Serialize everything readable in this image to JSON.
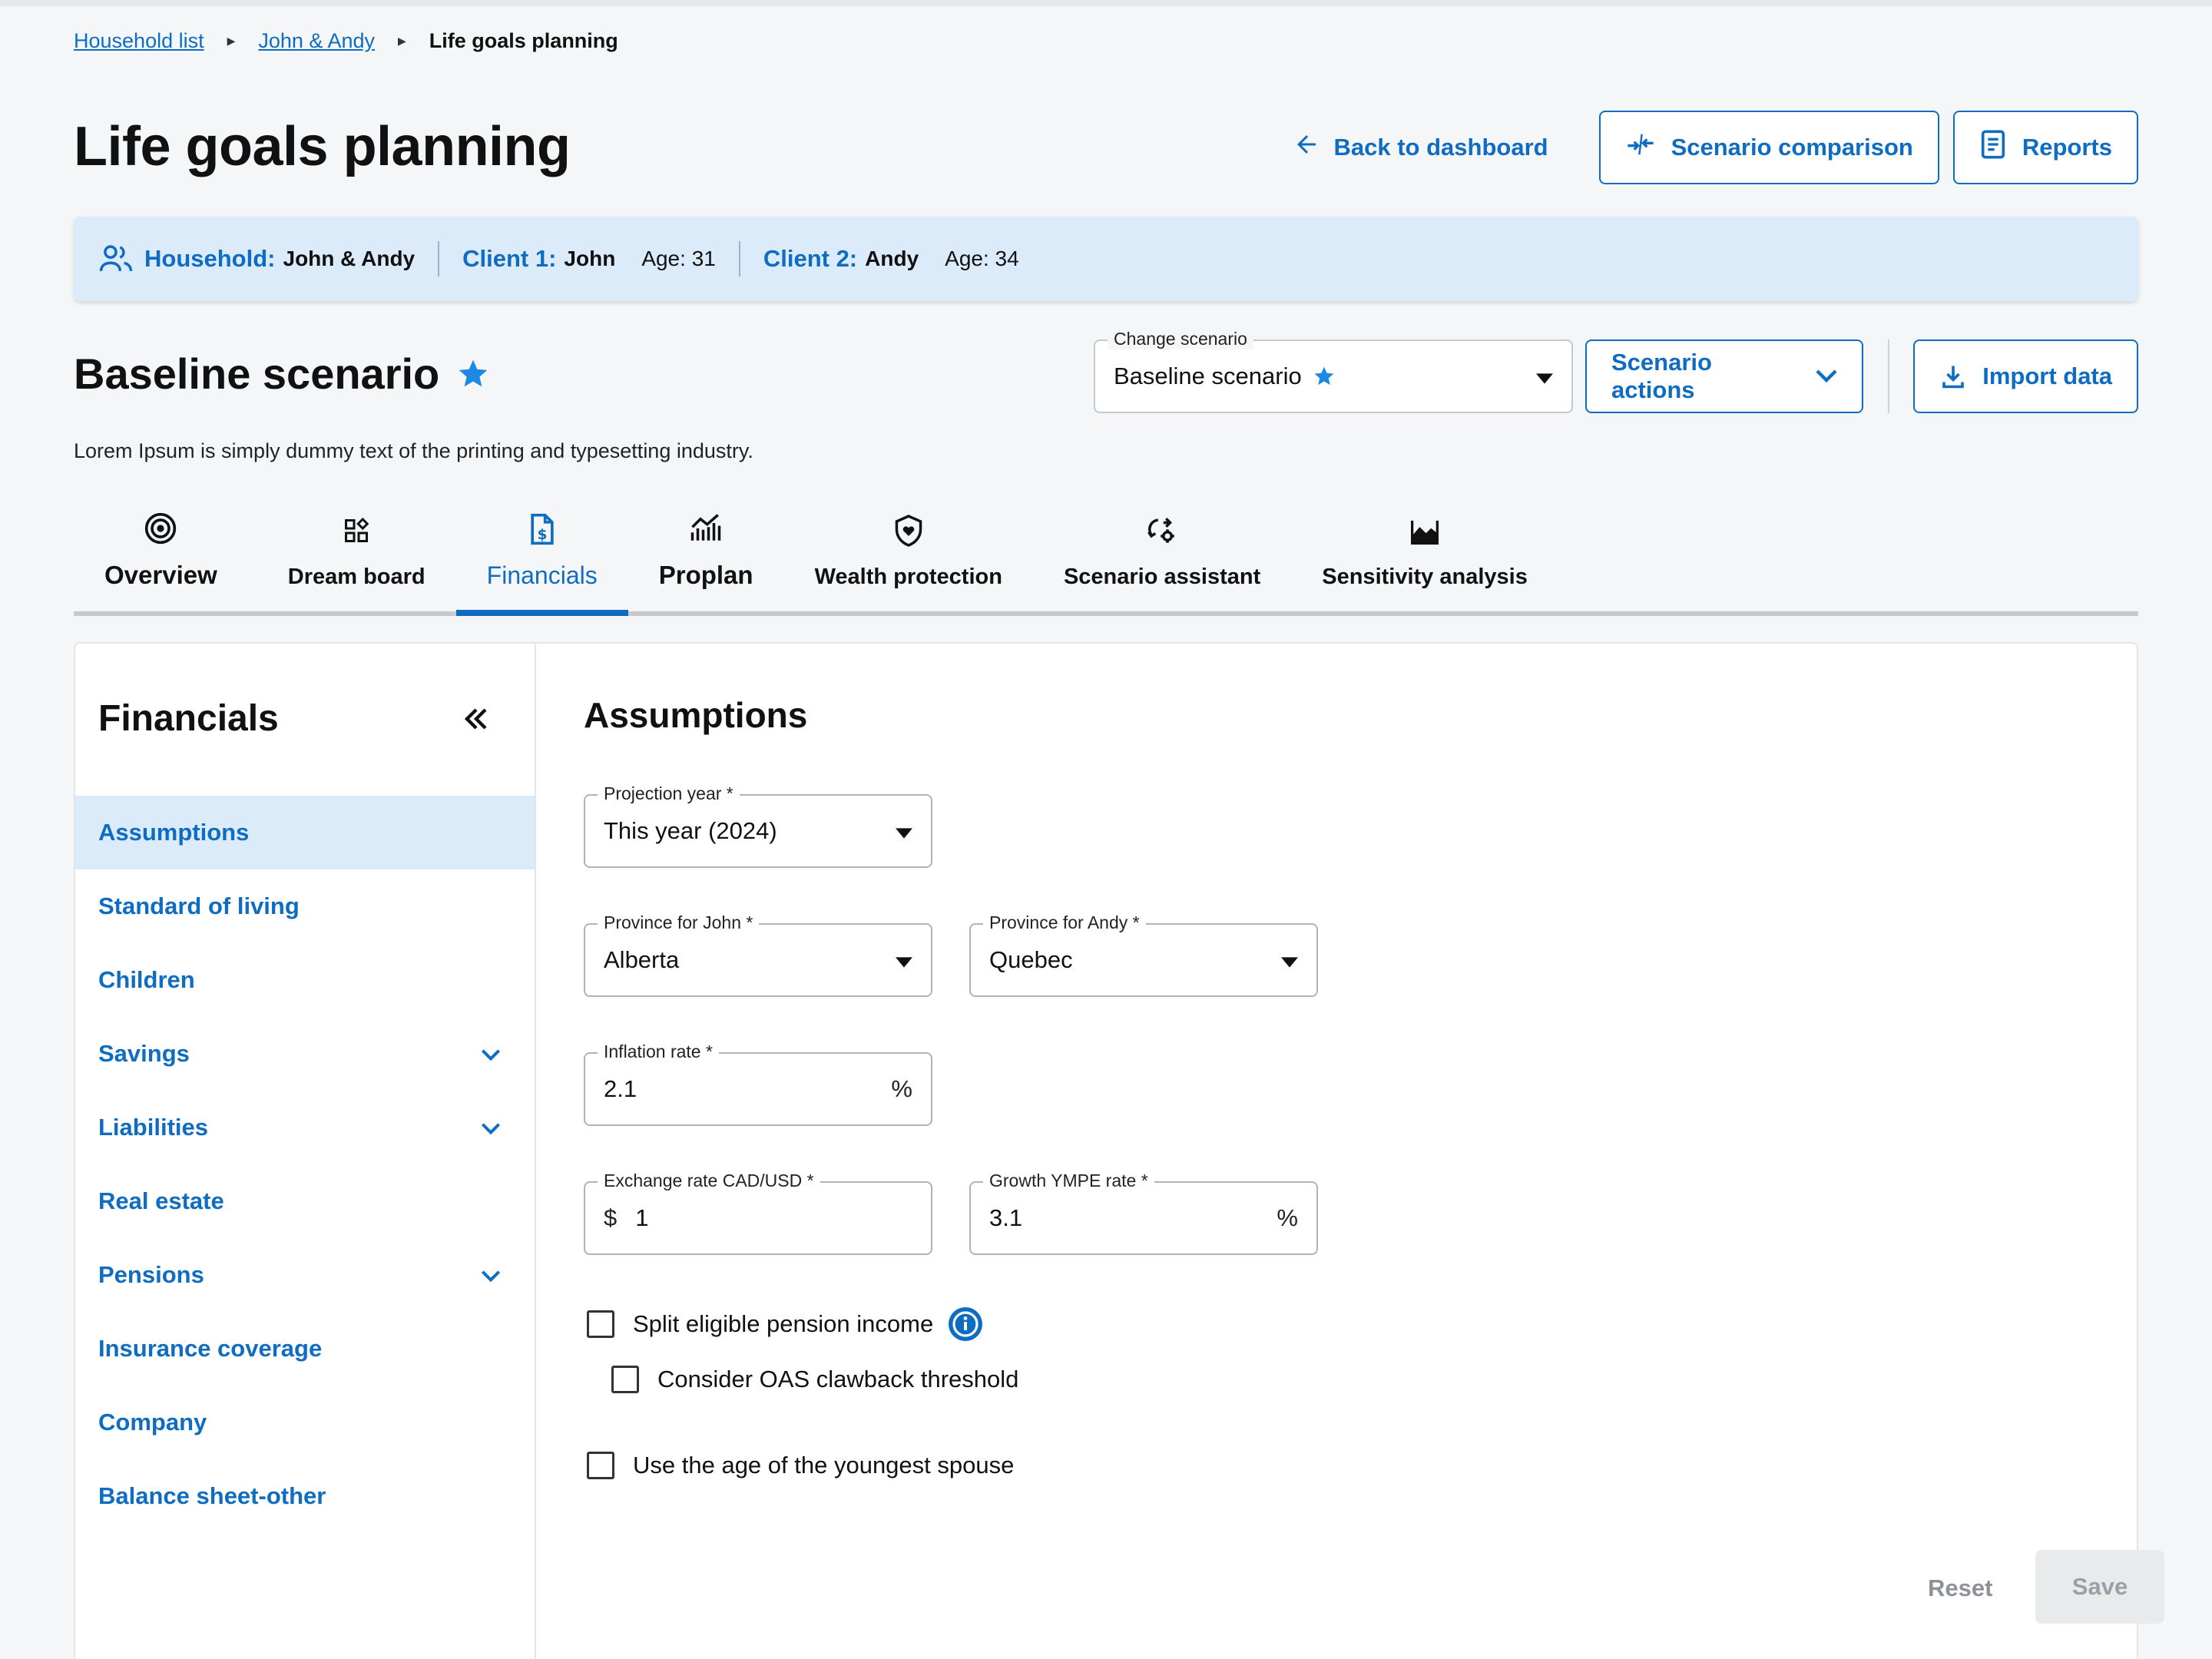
{
  "breadcrumb": {
    "items": [
      "Household list",
      "John & Andy"
    ],
    "current": "Life goals planning"
  },
  "header": {
    "title": "Life goals planning",
    "back_label": "Back to dashboard",
    "comparison_label": "Scenario comparison",
    "reports_label": "Reports"
  },
  "household": {
    "label": "Household:",
    "name": "John & Andy",
    "client1_label": "Client 1:",
    "client1_name": "John",
    "client1_age": "Age: 31",
    "client2_label": "Client 2:",
    "client2_name": "Andy",
    "client2_age": "Age: 34"
  },
  "scenario": {
    "title": "Baseline scenario",
    "description": "Lorem Ipsum is simply dummy text of the printing and typesetting industry.",
    "change_label": "Change scenario",
    "selected": "Baseline scenario",
    "actions_label": "Scenario actions",
    "import_label": "Import data"
  },
  "tabs": [
    {
      "label": "Overview",
      "icon": "target-icon"
    },
    {
      "label": "Dream board",
      "icon": "widgets-icon"
    },
    {
      "label": "Financials",
      "icon": "document-dollar-icon",
      "active": true
    },
    {
      "label": "Proplan",
      "icon": "chart-trend-icon"
    },
    {
      "label": "Wealth protection",
      "icon": "shield-heart-icon"
    },
    {
      "label": "Scenario assistant",
      "icon": "scenario-gear-icon"
    },
    {
      "label": "Sensitivity analysis",
      "icon": "area-chart-icon"
    }
  ],
  "sidebar": {
    "title": "Financials",
    "items": [
      {
        "label": "Assumptions",
        "active": true
      },
      {
        "label": "Standard of living"
      },
      {
        "label": "Children"
      },
      {
        "label": "Savings",
        "expandable": true
      },
      {
        "label": "Liabilities",
        "expandable": true
      },
      {
        "label": "Real estate"
      },
      {
        "label": "Pensions",
        "expandable": true
      },
      {
        "label": "Insurance coverage"
      },
      {
        "label": "Company"
      },
      {
        "label": "Balance sheet-other"
      }
    ]
  },
  "assumptions": {
    "title": "Assumptions",
    "projection_year": {
      "label": "Projection year *",
      "value": "This year (2024)"
    },
    "province_john": {
      "label": "Province for John *",
      "value": "Alberta"
    },
    "province_andy": {
      "label": "Province for Andy *",
      "value": "Quebec"
    },
    "inflation": {
      "label": "Inflation rate *",
      "value": "2.1",
      "suffix": "%"
    },
    "exchange": {
      "label": "Exchange rate CAD/USD *",
      "prefix": "$",
      "value": "1"
    },
    "ympe": {
      "label": "Growth YMPE rate *",
      "value": "3.1",
      "suffix": "%"
    },
    "split_pension": "Split eligible pension income",
    "oas_clawback": "Consider OAS clawback threshold",
    "youngest_spouse": "Use the age of the youngest spouse"
  },
  "footer": {
    "reset_label": "Reset",
    "save_label": "Save"
  },
  "colors": {
    "accent": "#0e6dc2",
    "household_bg": "#dcebfa",
    "page_bg": "#f5f6f8"
  }
}
